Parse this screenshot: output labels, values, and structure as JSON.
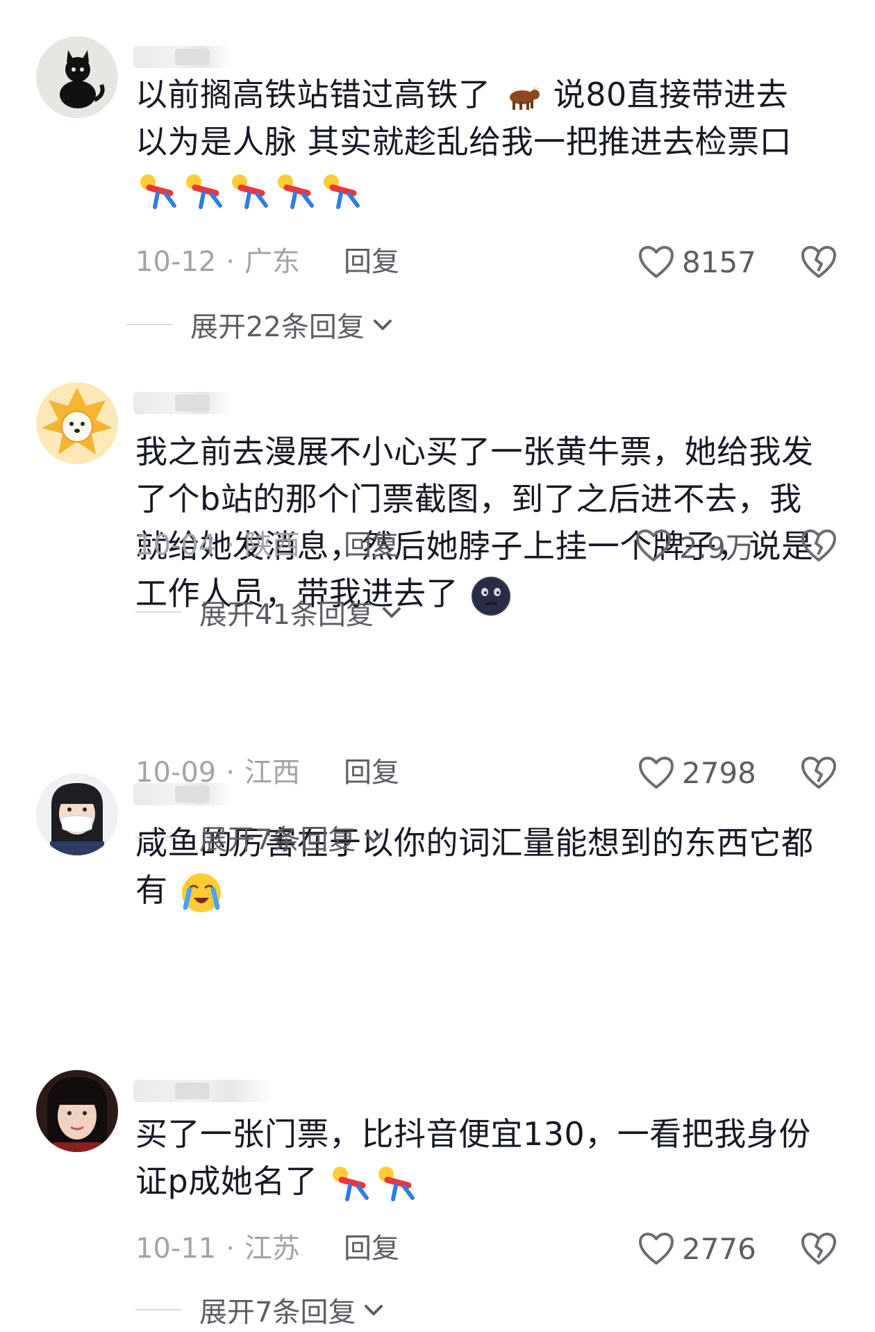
{
  "comments": [
    {
      "lines": [
        "以前搁高铁站错过高铁了",
        "说80直接带进去",
        "以为是人脉 其实就趁乱给我一把推进去检票口"
      ],
      "date": "10-12",
      "location": "广东",
      "reply_label": "回复",
      "likes": "8157",
      "expand_label": "展开22条回复"
    },
    {
      "lines": [
        "我之前去漫展不小心买了一张黄牛票，她给我发",
        "了个b站的那个门票截图，到了之后进不去，我",
        "就给她发消息，然后她脖子上挂一个牌子，说是",
        "工作人员，带我进去了"
      ],
      "date": "10-04",
      "location": "陕西",
      "reply_label": "回复",
      "likes": "2.9万",
      "expand_label": "展开41条回复"
    },
    {
      "lines": [
        "咸鱼的厉害在于以你的词汇量能想到的东西它都",
        "有"
      ],
      "date": "10-09",
      "location": "江西",
      "reply_label": "回复",
      "likes": "2798",
      "expand_label": "展开7条回复"
    },
    {
      "lines": [
        "买了一张门票，比抖音便宜130，一看把我身份",
        "证p成她名了"
      ],
      "date": "10-11",
      "location": "江苏",
      "reply_label": "回复",
      "likes": "2776",
      "expand_label": "展开7条回复"
    }
  ],
  "meta_separator": "·",
  "icons": {
    "like": "heart-outline-icon",
    "dislike": "broken-heart-icon",
    "expand": "chevron-down-icon"
  },
  "colors": {
    "text_primary": "#161823",
    "text_secondary": "#9a9ba1",
    "action_text": "#5c5d63"
  }
}
